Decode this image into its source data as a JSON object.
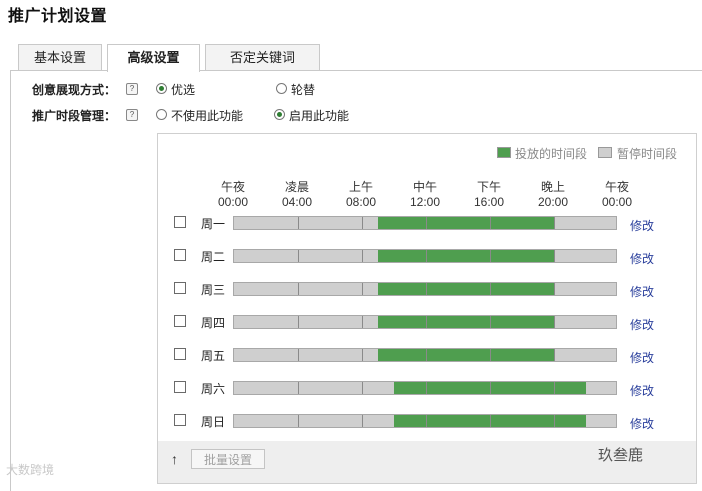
{
  "page": {
    "title": "推广计划设置"
  },
  "tabs": [
    {
      "label": "基本设置",
      "active": false
    },
    {
      "label": "高级设置",
      "active": true
    },
    {
      "label": "否定关键词",
      "active": false
    }
  ],
  "creative_display": {
    "label": "创意展现方式：",
    "help_icon": "?",
    "options": [
      {
        "label": "优选",
        "checked": true
      },
      {
        "label": "轮替",
        "checked": false
      }
    ]
  },
  "time_management": {
    "label": "推广时段管理：",
    "help_icon": "?",
    "options": [
      {
        "label": "不使用此功能",
        "checked": false
      },
      {
        "label": "启用此功能",
        "checked": true
      }
    ]
  },
  "schedule": {
    "legend": {
      "active_label": "投放的时间段",
      "paused_label": "暂停时间段",
      "active_color": "#4f9e4f",
      "paused_color": "#cfcfcf"
    },
    "time_headers": [
      {
        "period": "午夜",
        "time": "00:00"
      },
      {
        "period": "凌晨",
        "time": "04:00"
      },
      {
        "period": "上午",
        "time": "08:00"
      },
      {
        "period": "中午",
        "time": "12:00"
      },
      {
        "period": "下午",
        "time": "16:00"
      },
      {
        "period": "晚上",
        "time": "20:00"
      },
      {
        "period": "午夜",
        "time": "00:00"
      }
    ],
    "edit_label": "修改",
    "days": [
      {
        "name": "周一",
        "checked": false,
        "active_start": 9,
        "active_end": 20
      },
      {
        "name": "周二",
        "checked": false,
        "active_start": 9,
        "active_end": 20
      },
      {
        "name": "周三",
        "checked": false,
        "active_start": 9,
        "active_end": 20
      },
      {
        "name": "周四",
        "checked": false,
        "active_start": 9,
        "active_end": 20
      },
      {
        "name": "周五",
        "checked": false,
        "active_start": 9,
        "active_end": 20
      },
      {
        "name": "周六",
        "checked": false,
        "active_start": 10,
        "active_end": 22
      },
      {
        "name": "周日",
        "checked": false,
        "active_start": 10,
        "active_end": 22
      }
    ]
  },
  "footer": {
    "up_icon": "↑",
    "batch_button_label": "批量设置"
  },
  "watermarks": {
    "left": "大数跨境",
    "right": "玖叁鹿"
  }
}
